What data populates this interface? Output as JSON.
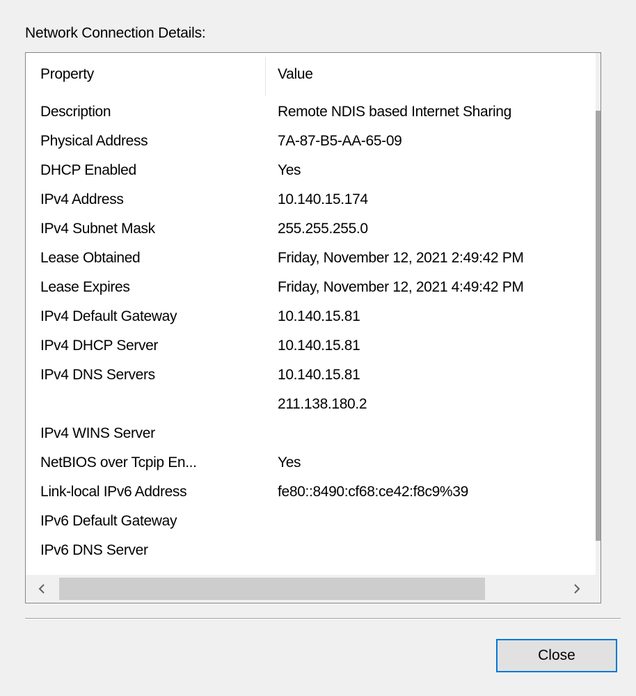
{
  "dialog": {
    "group_label": "Network Connection Details:",
    "close_label": "Close"
  },
  "list": {
    "columns": [
      "Property",
      "Value"
    ],
    "rows": [
      {
        "property": "Description",
        "value": "Remote NDIS based Internet Sharing"
      },
      {
        "property": "Physical Address",
        "value": "7A-87-B5-AA-65-09"
      },
      {
        "property": "DHCP Enabled",
        "value": "Yes"
      },
      {
        "property": "IPv4 Address",
        "value": "10.140.15.174"
      },
      {
        "property": "IPv4 Subnet Mask",
        "value": "255.255.255.0"
      },
      {
        "property": "Lease Obtained",
        "value": "Friday, November 12, 2021 2:49:42 PM"
      },
      {
        "property": "Lease Expires",
        "value": "Friday, November 12, 2021 4:49:42 PM"
      },
      {
        "property": "IPv4 Default Gateway",
        "value": "10.140.15.81"
      },
      {
        "property": "IPv4 DHCP Server",
        "value": "10.140.15.81"
      },
      {
        "property": "IPv4 DNS Servers",
        "value": "10.140.15.81"
      },
      {
        "property": "",
        "value": "211.138.180.2"
      },
      {
        "property": "IPv4 WINS Server",
        "value": ""
      },
      {
        "property": "NetBIOS over Tcpip En...",
        "value": "Yes"
      },
      {
        "property": "Link-local IPv6 Address",
        "value": "fe80::8490:cf68:ce42:f8c9%39"
      },
      {
        "property": "IPv6 Default Gateway",
        "value": ""
      },
      {
        "property": "IPv6 DNS Server",
        "value": ""
      }
    ]
  },
  "icons": {
    "scroll_up": "chevron-up-icon",
    "scroll_down": "chevron-down-icon",
    "scroll_left": "chevron-left-icon",
    "scroll_right": "chevron-right-icon"
  },
  "colors": {
    "focus_border": "#0078d7",
    "scroll_thumb": "#a6a6a6"
  }
}
